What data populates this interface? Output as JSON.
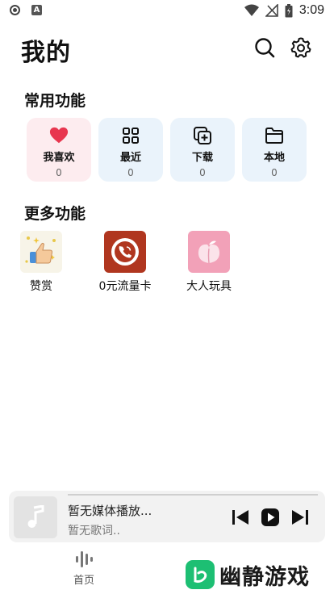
{
  "status_bar": {
    "time": "3:09"
  },
  "header": {
    "title": "我的"
  },
  "common": {
    "title": "常用功能",
    "items": [
      {
        "label": "我喜欢",
        "count": "0",
        "icon": "heart-icon"
      },
      {
        "label": "最近",
        "count": "0",
        "icon": "grid-icon"
      },
      {
        "label": "下载",
        "count": "0",
        "icon": "download-add-icon"
      },
      {
        "label": "本地",
        "count": "0",
        "icon": "folder-icon"
      }
    ]
  },
  "more": {
    "title": "更多功能",
    "items": [
      {
        "label": "赞赏",
        "icon": "thumbs-up-icon"
      },
      {
        "label": "0元流量卡",
        "icon": "phone-icon"
      },
      {
        "label": "大人玩具",
        "icon": "peach-icon"
      }
    ]
  },
  "player": {
    "title": "暂无媒体播放...",
    "lyric": "暂无歌词.."
  },
  "nav": {
    "home_label": "首页"
  },
  "watermark": {
    "text": "幽静游戏"
  },
  "colors": {
    "heart": "#e8364f",
    "fav_card": "#fdecef",
    "card": "#eaf3fb",
    "brand_green": "#1dbf73"
  }
}
